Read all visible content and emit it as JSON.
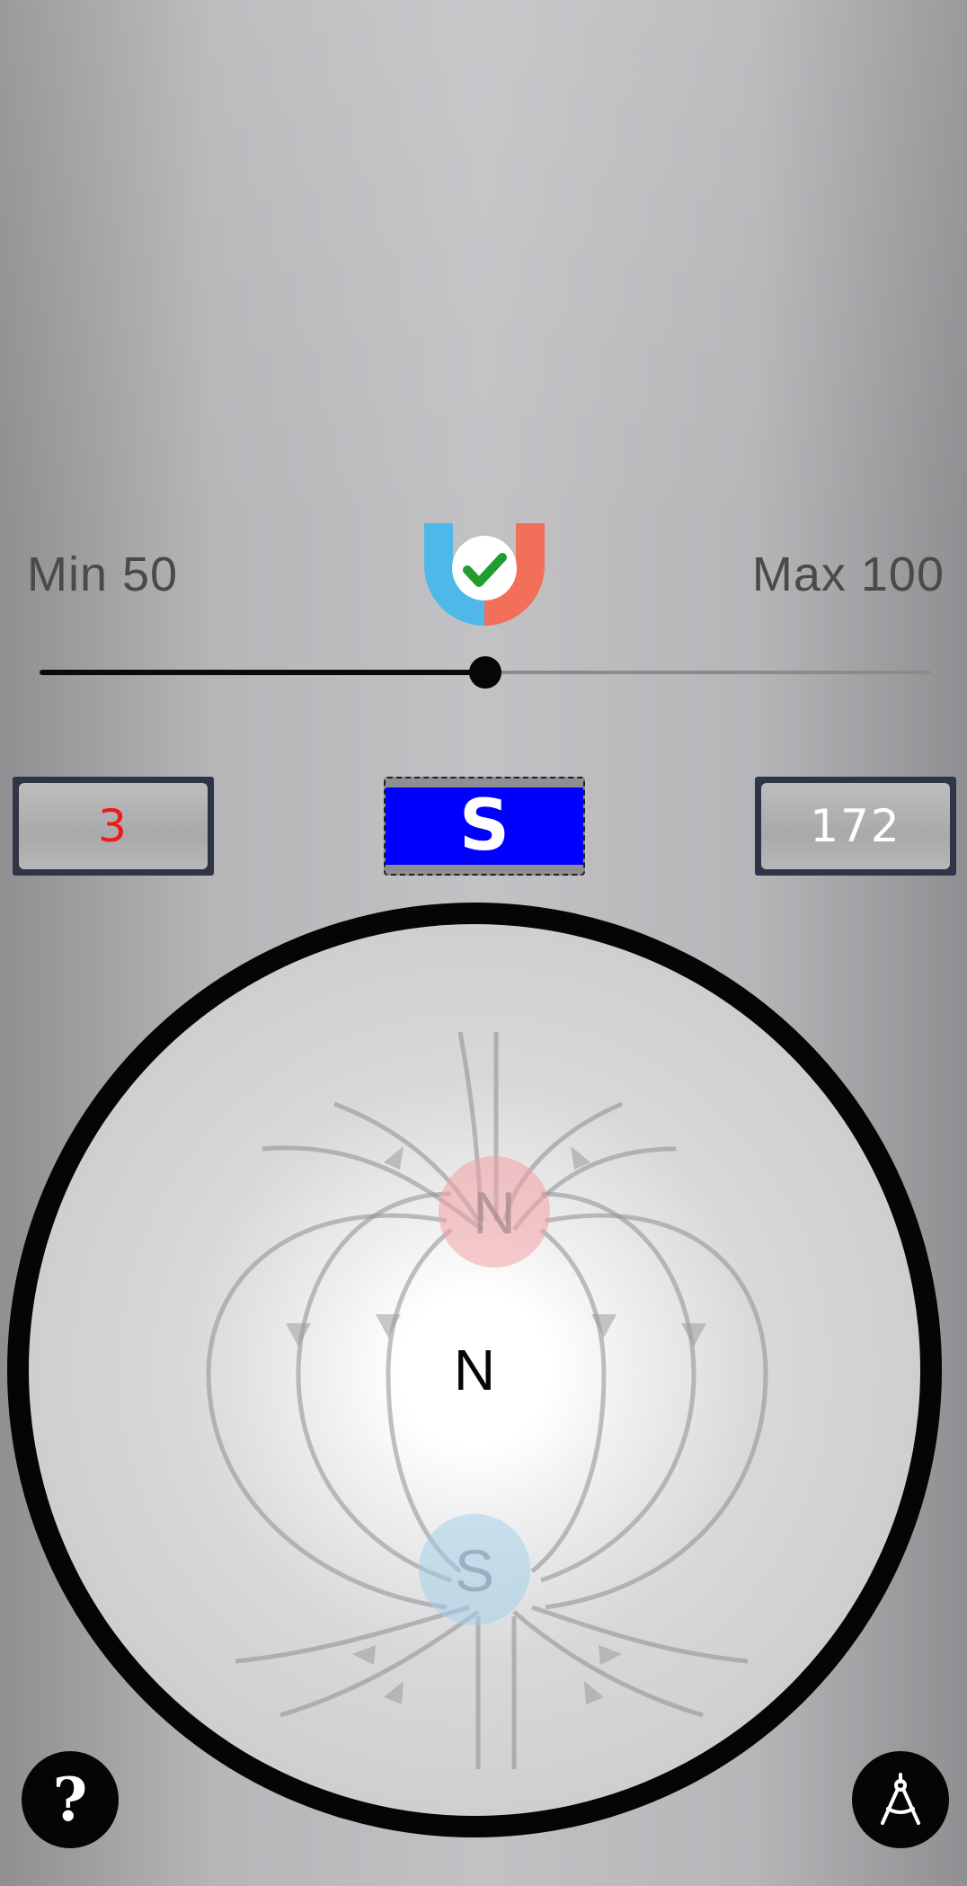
{
  "threshold": {
    "min_label": "Min 50",
    "max_label": "Max 100",
    "slider_fraction": 0.5
  },
  "magnet_status": {
    "icon": "magnet-check-icon",
    "left_color": "#4eb8e9",
    "right_color": "#f26f59",
    "check_color": "#1f9e2e"
  },
  "readouts": {
    "left_value": "3",
    "left_color": "#ee1a1a",
    "pole_label": "S",
    "pole_color": "#0000ff",
    "right_value": "172"
  },
  "dial": {
    "center_label": "N",
    "top_pole": "N",
    "bottom_pole": "S",
    "top_pole_color": "#f2a0a4",
    "bottom_pole_color": "#9fd0ea"
  },
  "buttons": {
    "help_icon": "question-mark-icon",
    "help_glyph": "?",
    "compass_icon": "drawing-compass-icon"
  }
}
